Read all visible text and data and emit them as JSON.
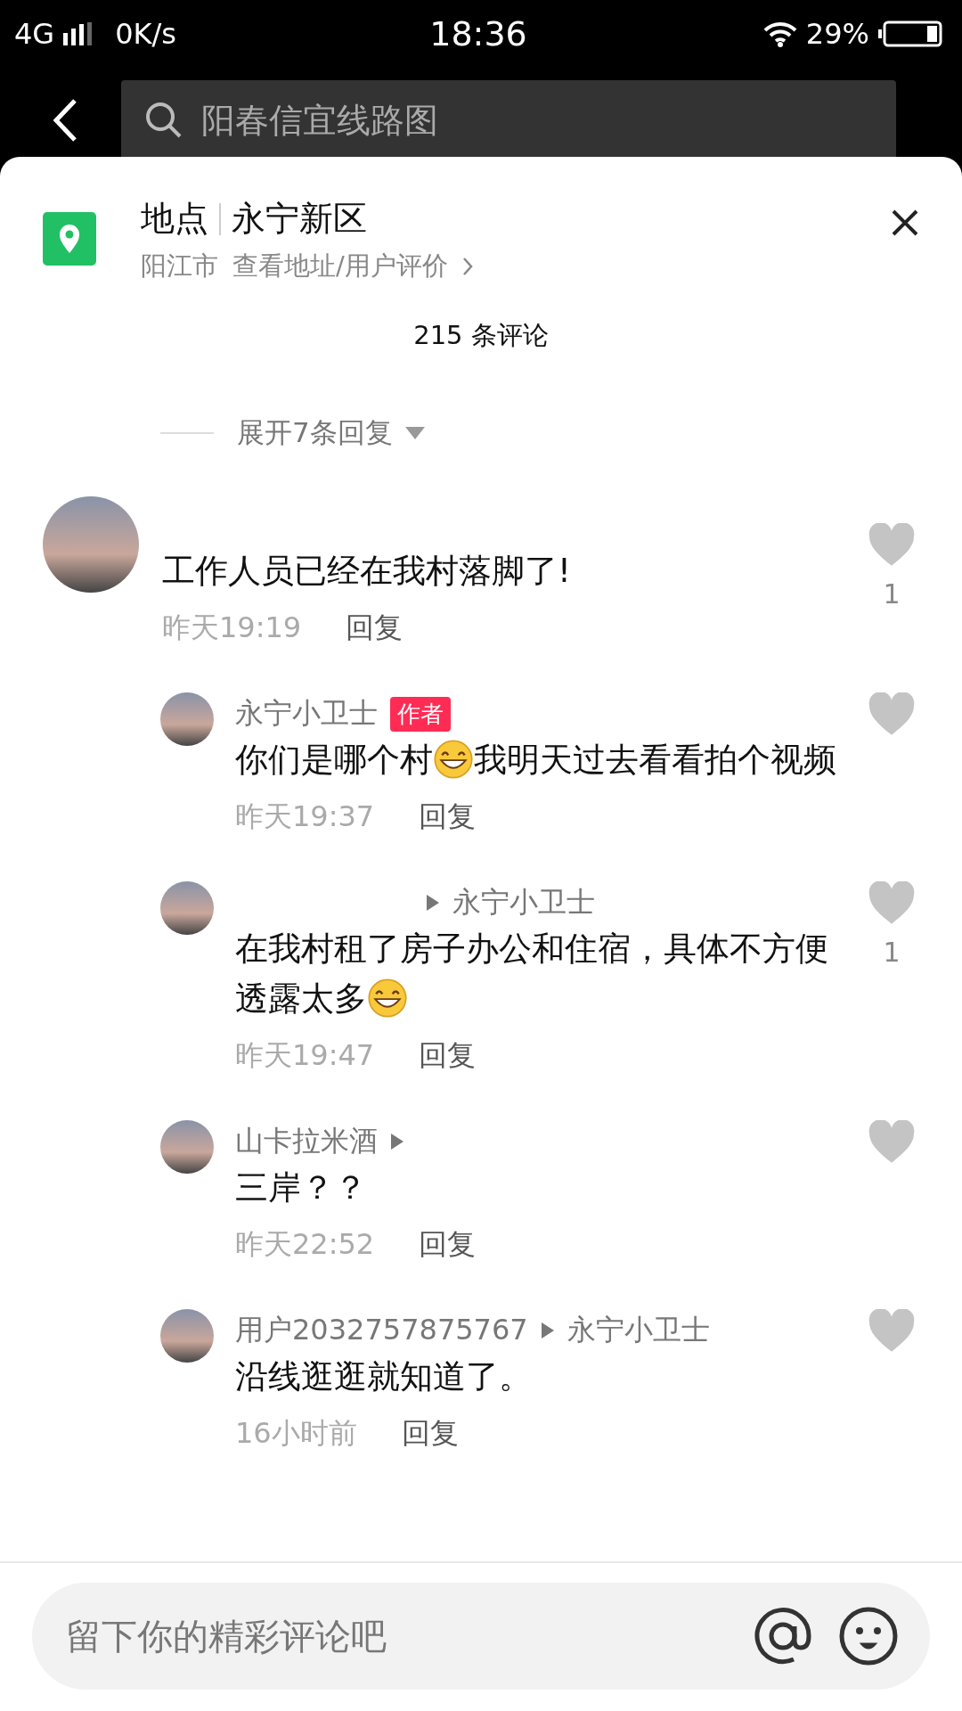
{
  "status_bar": {
    "network": "4G",
    "speed": "0K/s",
    "time": "18:36",
    "battery": "29%"
  },
  "search": {
    "value": "阳春信宜线路图"
  },
  "place": {
    "label": "地点",
    "name": "永宁新区",
    "city": "阳江市",
    "link": "查看地址/用户评价"
  },
  "comment_count": "215 条评论",
  "expand_replies": "展开7条回复",
  "comments": [
    {
      "text": [
        {
          "kind": "text",
          "text": "工作人员已经在我村落脚了!"
        }
      ],
      "time": "昨天19:19",
      "reply": "回复",
      "liked": false,
      "likes": "1",
      "replies": [
        {
          "name": "永宁小卫士",
          "badge": "作者",
          "text": [
            {
              "kind": "text",
              "text": "你们是哪个村"
            },
            {
              "kind": "emoji"
            },
            {
              "kind": "text",
              "text": "我明天过去看看拍个视频"
            }
          ],
          "time": "昨天19:37",
          "reply": "回复",
          "liked": false
        },
        {
          "reply_to": "永宁小卫士",
          "text": [
            {
              "kind": "text",
              "text": "在我村租了房子办公和住宿，具体不方便透露太多"
            },
            {
              "kind": "emoji"
            }
          ],
          "time": "昨天19:47",
          "reply": "回复",
          "liked": false,
          "likes": "1"
        },
        {
          "name": "山卡拉米酒",
          "reply_to_arrow": true,
          "text": [
            {
              "kind": "text",
              "text": "三岸？？"
            }
          ],
          "time": "昨天22:52",
          "reply": "回复",
          "liked": false
        },
        {
          "name": "用户2032757875767",
          "reply_to": "永宁小卫士",
          "text": [
            {
              "kind": "text",
              "text": "沿线逛逛就知道了。"
            }
          ],
          "time": "16小时前",
          "reply": "回复",
          "liked": false
        }
      ]
    }
  ],
  "comment_input": {
    "placeholder": "留下你的精彩评论吧"
  }
}
